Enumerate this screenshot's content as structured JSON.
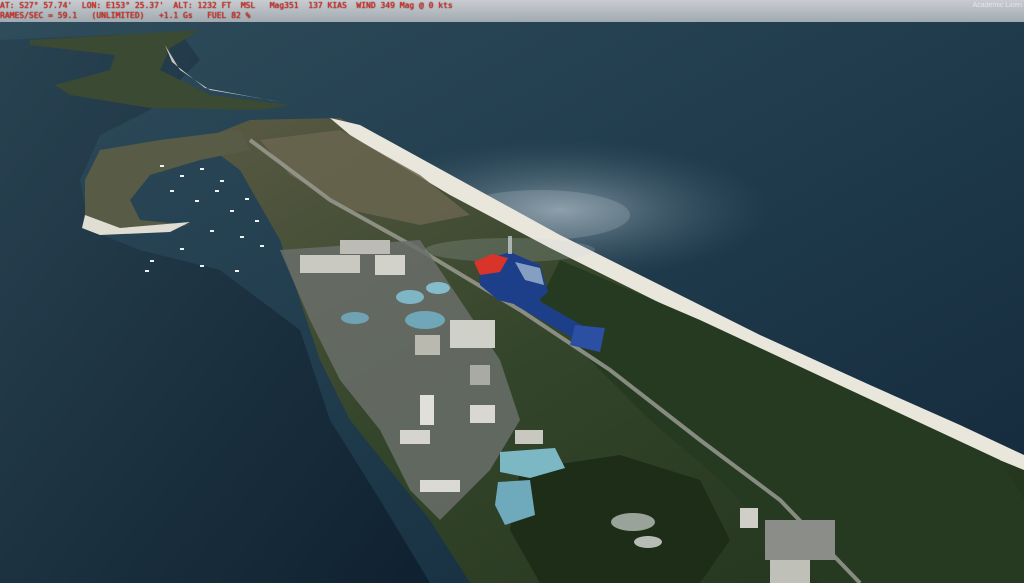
{
  "hud": {
    "line1": "AT: S27° 57.74'  LON: E153° 25.37'  ALT: 1232 FT  MSL   Mag351  137 KIAS  WIND 349 Mag @ 0 kts",
    "line2": "RAMES/SEC = 59.1   (UNLIMITED)   +1.1 Gs   FUEL 82 %"
  },
  "watermark": "Academic Licen",
  "colors": {
    "hud_text": "#ff2a1a",
    "ocean": "#1f3a4a",
    "beach": "#e9e6dc",
    "vegetation": "#2e3f26",
    "helicopter_body": "#1d3f8a",
    "helicopter_nose": "#d8342a"
  }
}
